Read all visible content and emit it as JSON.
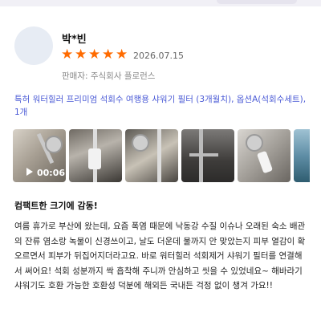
{
  "review": {
    "reviewer": "박*빈",
    "rating": 5,
    "date": "2026.07.15",
    "seller": "판매자: 주식회사 플로런스",
    "product": "특허 워터힐러 프리미엄 석회수 여행용 샤워기 필터 (3개월치), 옵션A(석회수세트), 1개",
    "video_duration": "00:06",
    "title": "컴팩트한 크기에 감동!",
    "body": "여름 휴가로 부산에 왔는데, 요즘 폭염 때문에 낙동강 수질 이슈나 오래된 숙소 배관의 잔류 염소랑 녹물이 신경쓰이고, 날도 더운데 물까지 안 맞았는지 피부 열감이 확 오르면서 피부가 뒤집어지더라고요. 바로 워터힐러 석회제거 샤워기 필터를 연결해서 써어요! 석회 성분까지 싹 흡착해 주니까 안심하고 씻을 수 있었네요~ 해바라기샤워기도 호환 가능한 호환성 덕분에 해외든 국내든 걱정 없이 챙겨 가요!!"
  },
  "icons": {
    "star": "star-icon",
    "play": "play-icon"
  },
  "colors": {
    "star": "#ff6b00",
    "product_link": "#4a5ad6"
  }
}
